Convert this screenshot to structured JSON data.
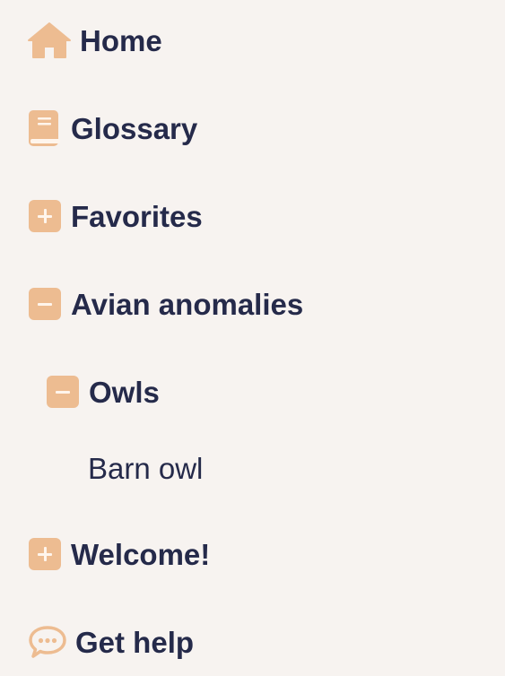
{
  "colors": {
    "background": "#f7f3f0",
    "icon": "#edbc91",
    "text": "#252a4a"
  },
  "nav": {
    "items": [
      {
        "label": "Home",
        "icon": "home-icon"
      },
      {
        "label": "Glossary",
        "icon": "book-icon"
      },
      {
        "label": "Favorites",
        "icon": "plus-square-icon",
        "state": "collapsed"
      },
      {
        "label": "Avian anomalies",
        "icon": "minus-square-icon",
        "state": "expanded",
        "children": [
          {
            "label": "Owls",
            "icon": "minus-square-icon",
            "state": "expanded",
            "children": [
              {
                "label": "Barn owl"
              }
            ]
          }
        ]
      },
      {
        "label": "Welcome!",
        "icon": "plus-square-icon",
        "state": "collapsed"
      },
      {
        "label": "Get help",
        "icon": "chat-bubble-icon"
      }
    ]
  }
}
